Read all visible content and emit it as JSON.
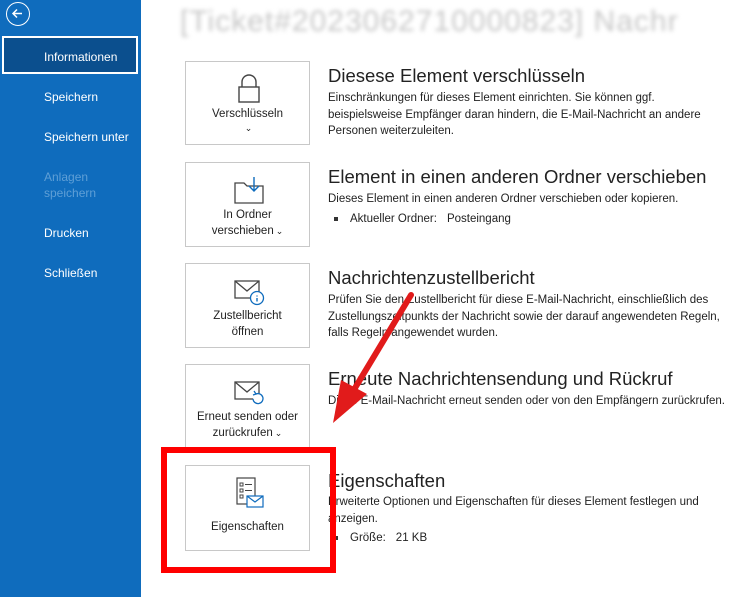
{
  "window": {
    "title": "[Ticket#2023062710000823] Nachr"
  },
  "sidebar": {
    "items": [
      {
        "label": "Informationen",
        "active": true,
        "disabled": false
      },
      {
        "label": "Speichern",
        "disabled": false
      },
      {
        "label": "Speichern unter",
        "disabled": false
      },
      {
        "label": "Anlagen speichern",
        "disabled": true
      },
      {
        "label": "Drucken",
        "disabled": false
      },
      {
        "label": "Schließen",
        "disabled": false
      }
    ]
  },
  "sections": [
    {
      "tile_label": "Verschlüsseln",
      "icon": "lock-icon",
      "title": "Diesese Element verschlüsseln",
      "description": "Einschränkungen für dieses Element einrichten. Sie können ggf. beispielsweise Empfänger daran hindern, die E-Mail-Nachricht an andere Personen weiterzuleiten."
    },
    {
      "tile_label_line1": "In Ordner",
      "tile_label_line2": "verschieben",
      "icon": "move-folder-icon",
      "title": "Element in einen anderen Ordner verschieben",
      "description": "Dieses Element in einen anderen Ordner verschieben oder kopieren.",
      "bullet_label": "Aktueller Ordner:",
      "bullet_value": "Posteingang"
    },
    {
      "tile_label_line1": "Zustellbericht",
      "tile_label_line2": "öffnen",
      "icon": "delivery-report-icon",
      "title": "Nachrichtenzustellbericht",
      "description": "Prüfen Sie den Zustellbericht für diese E-Mail-Nachricht, einschließlich des Zustellungszeitpunkts der Nachricht sowie der darauf angewendeten Regeln, falls Regeln angewendet wurden."
    },
    {
      "tile_label_line1": "Erneut senden oder",
      "tile_label_line2": "zurückrufen",
      "icon": "resend-icon",
      "title": "Erneute Nachrichtensendung und Rückruf",
      "description": "Diese E-Mail-Nachricht erneut senden oder von den Empfängern zurückrufen."
    },
    {
      "tile_label": "Eigenschaften",
      "icon": "properties-icon",
      "title": "Eigenschaften",
      "description": "Erweiterte Optionen und Eigenschaften für dieses Element festlegen und anzeigen.",
      "bullet_label": "Größe:",
      "bullet_value": "21 KB"
    }
  ],
  "colors": {
    "sidebar": "#0f6cbd",
    "annotation": "#ff0000"
  }
}
